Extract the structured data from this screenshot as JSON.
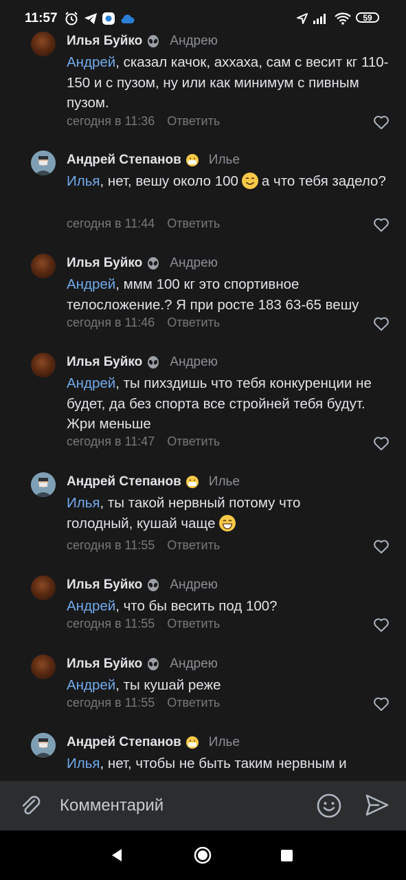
{
  "status_bar": {
    "time": "11:57",
    "battery": "59",
    "icons": [
      "alarm-icon",
      "telegram-icon",
      "app-icon",
      "cloud-icon",
      "location-icon",
      "signal-icon",
      "wifi-icon",
      "battery-icon"
    ]
  },
  "comments": [
    {
      "author": "Илья Буйко",
      "author_emoji": "alien",
      "reply_to": "Андрею",
      "mention": "Андрей",
      "text": ", сказал качок, аххаха, сам с весит кг 110-150 и с пузом, ну или как минимум с пивным пузом.",
      "time": "сегодня в 11:36",
      "reply_label": "Ответить"
    },
    {
      "author": "Андрей Степанов",
      "author_emoji": "mask",
      "reply_to": "Илье",
      "mention": "Илья",
      "text_before": ", нет, вешу около 100",
      "text_after": "а что тебя задело?",
      "time": "сегодня в 11:44",
      "reply_label": "Ответить"
    },
    {
      "author": "Илья Буйко",
      "author_emoji": "alien",
      "reply_to": "Андрею",
      "mention": "Андрей",
      "text": ", ммм 100 кг это спортивное телосложение.? Я при росте 183 63-65 вешу",
      "time": "сегодня в 11:46",
      "reply_label": "Ответить"
    },
    {
      "author": "Илья Буйко",
      "author_emoji": "alien",
      "reply_to": "Андрею",
      "mention": "Андрей",
      "text": ", ты пихздишь что тебя конкуренции не будет, да без спорта все стройней тебя будут. Жри меньше",
      "time": "сегодня в 11:47",
      "reply_label": "Ответить"
    },
    {
      "author": "Андрей Степанов",
      "author_emoji": "mask",
      "reply_to": "Илье",
      "mention": "Илья",
      "text": ", ты такой нервный потому что голодный, кушай чаще",
      "time": "сегодня в 11:55",
      "reply_label": "Ответить"
    },
    {
      "author": "Илья Буйко",
      "author_emoji": "alien",
      "reply_to": "Андрею",
      "mention": "Андрей",
      "text": ", что бы весить под 100?",
      "time": "сегодня в 11:55",
      "reply_label": "Ответить"
    },
    {
      "author": "Илья Буйко",
      "author_emoji": "alien",
      "reply_to": "Андрею",
      "mention": "Андрей",
      "text": ", ты кушай реже",
      "time": "сегодня в 11:55",
      "reply_label": "Ответить"
    },
    {
      "author": "Андрей Степанов",
      "author_emoji": "mask",
      "reply_to": "Илье",
      "mention": "Илья",
      "text": ", нет, чтобы не быть таким нервным и раздражительным"
    }
  ],
  "input": {
    "placeholder": "Комментарий"
  },
  "colors": {
    "background": "#19191a",
    "mention": "#71aaeb",
    "meta": "#76787a",
    "input_bar": "#2c2d2e"
  }
}
